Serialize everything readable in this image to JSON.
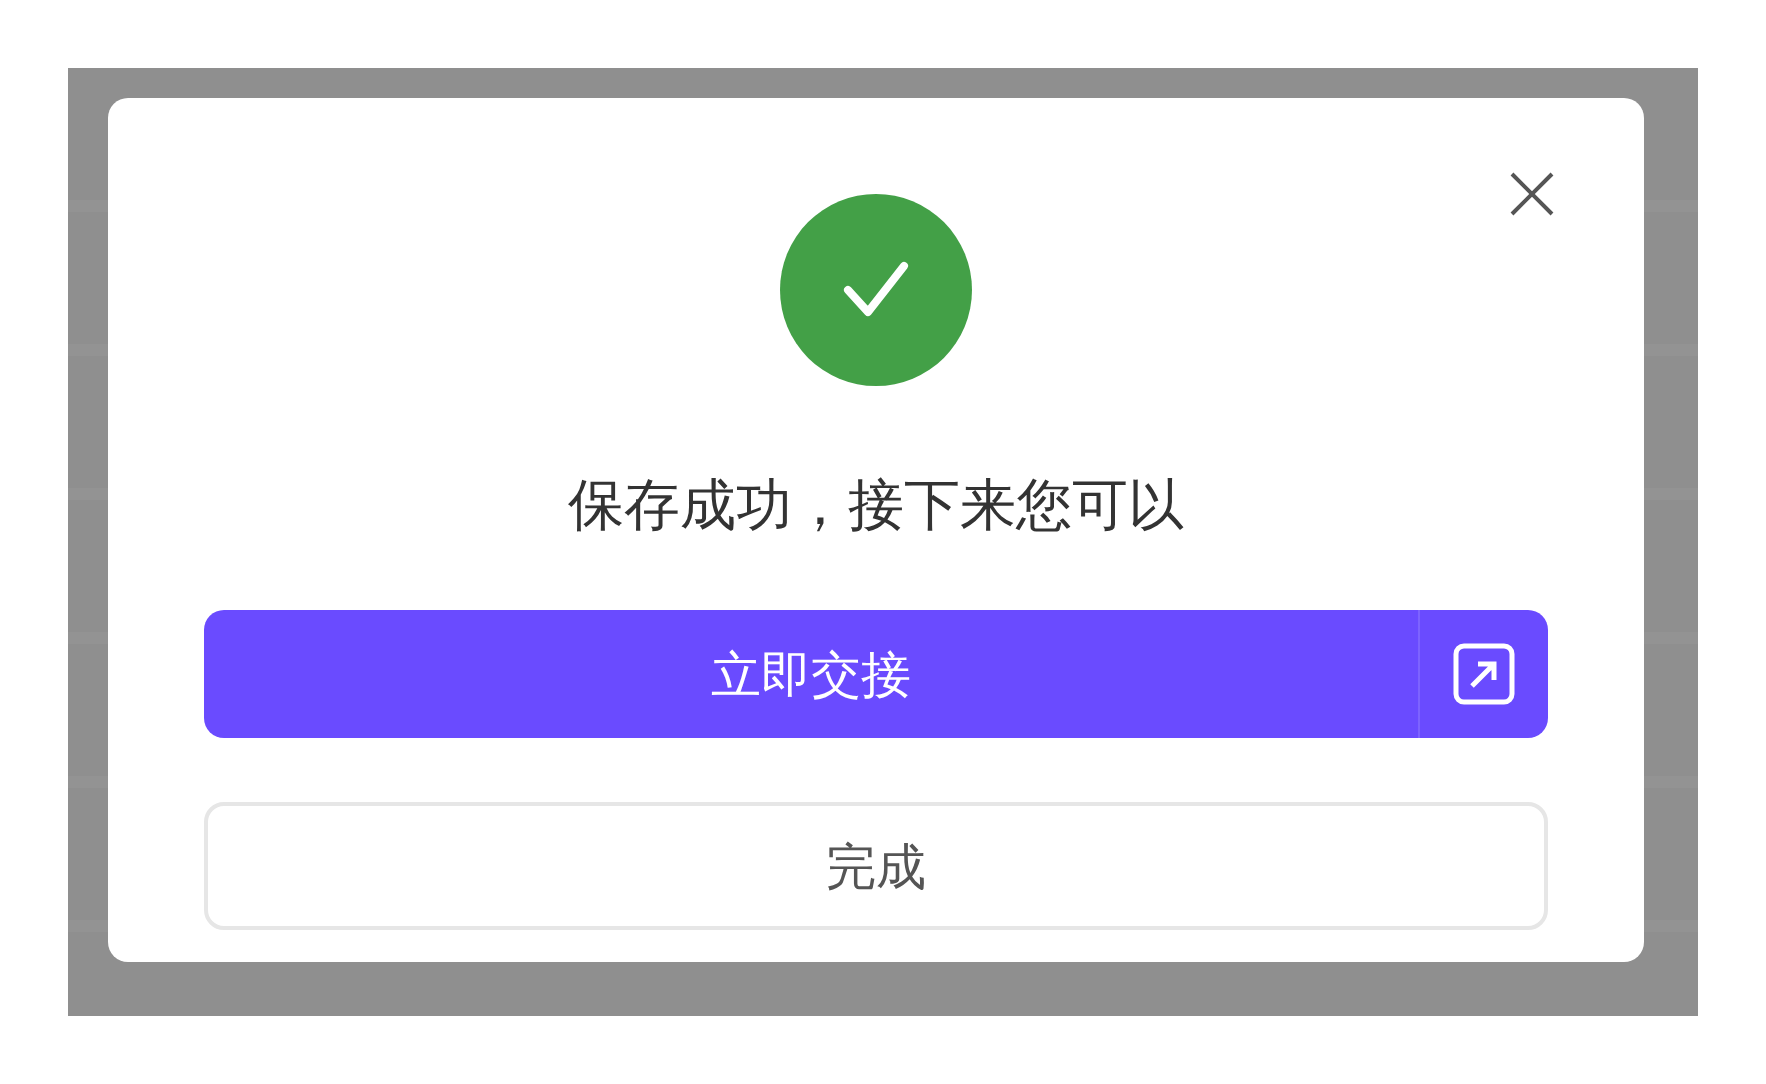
{
  "dialog": {
    "title": "保存成功，接下来您可以",
    "primary_button": {
      "label": "立即交接"
    },
    "secondary_button": {
      "label": "完成"
    }
  }
}
